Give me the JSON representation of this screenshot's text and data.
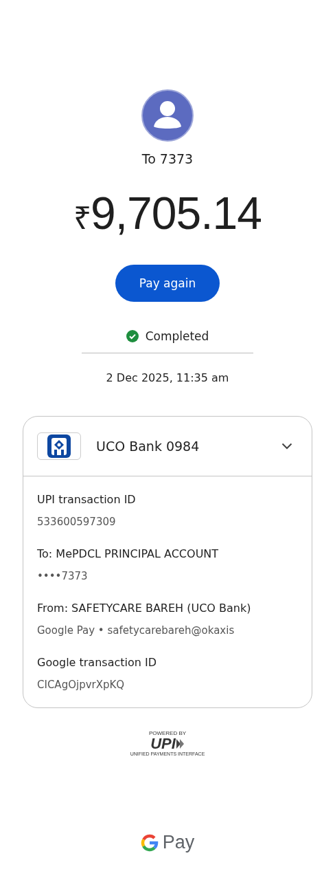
{
  "recipient": {
    "label": "To 7373"
  },
  "amount": {
    "currency": "₹",
    "value": "9,705.14"
  },
  "pay_again_button": "Pay again",
  "status": {
    "kind": "completed",
    "label": "Completed"
  },
  "timestamp": "2 Dec 2025, 11:35 am",
  "account_card": {
    "bank": "UCO Bank 0984",
    "expanded": true,
    "details": [
      {
        "label": "UPI transaction ID",
        "value": "533600597309"
      },
      {
        "label": "To: MePDCL PRINCIPAL ACCOUNT",
        "value": "••••7373"
      },
      {
        "label": "From: SAFETYCARE BAREH (UCO Bank)",
        "value": "Google Pay • safetycarebareh@okaxis"
      },
      {
        "label": "Google transaction ID",
        "value": "CICAgOjpvrXpKQ"
      }
    ]
  },
  "upi_badge": {
    "caption": "POWERED BY",
    "mark": "UPI",
    "subtitle": "UNIFIED PAYMENTS INTERFACE"
  },
  "footer_brand": "Pay"
}
